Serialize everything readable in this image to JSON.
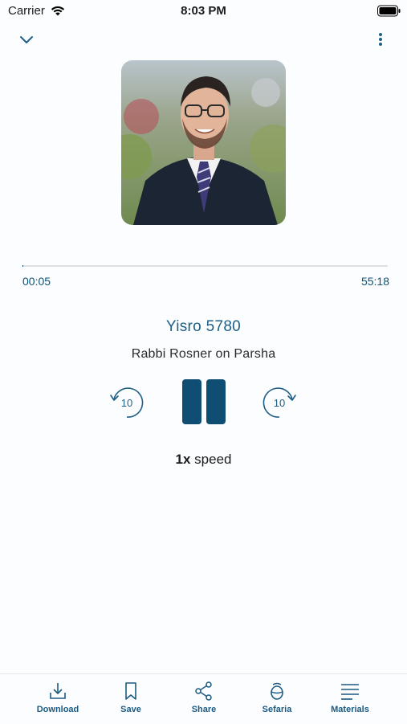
{
  "status": {
    "carrier": "Carrier",
    "time": "8:03 PM"
  },
  "player": {
    "current_time": "00:05",
    "total_time": "55:18",
    "progress_fraction": 0.0015,
    "title": "Yisro 5780",
    "subtitle": "Rabbi Rosner on Parsha",
    "rewind_seconds": "10",
    "forward_seconds": "10",
    "speed_value": "1x",
    "speed_label": "speed"
  },
  "tabs": [
    {
      "label": "Download",
      "icon": "download-icon"
    },
    {
      "label": "Save",
      "icon": "bookmark-icon"
    },
    {
      "label": "Share",
      "icon": "share-icon"
    },
    {
      "label": "Sefaria",
      "icon": "sefaria-icon"
    },
    {
      "label": "Materials",
      "icon": "materials-icon"
    }
  ],
  "colors": {
    "accent": "#0f4d73",
    "title": "#1e5f87",
    "label": "#1c5a82"
  }
}
